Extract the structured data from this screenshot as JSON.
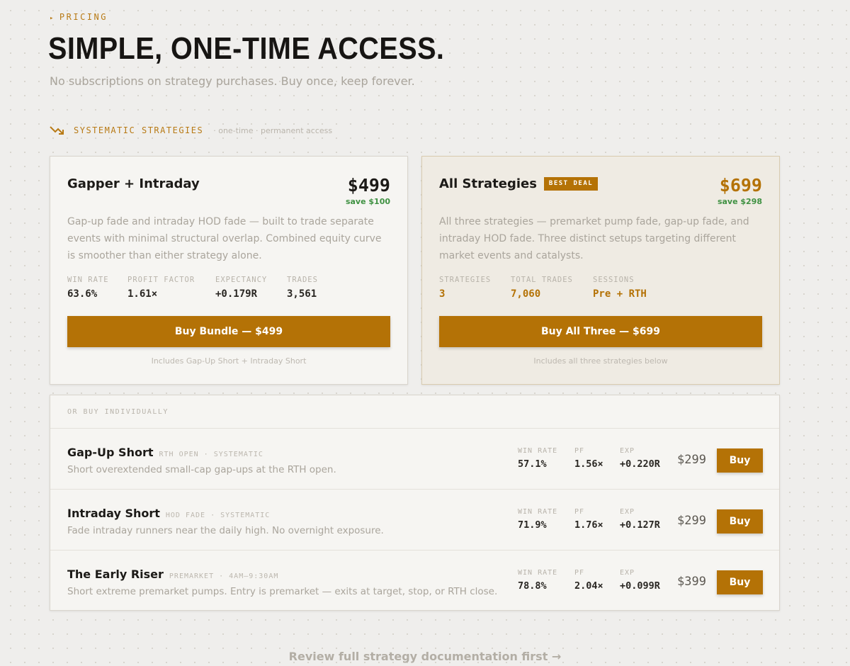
{
  "header": {
    "section_label": "PRICING",
    "title": "SIMPLE, ONE-TIME ACCESS.",
    "subtitle": "No subscriptions on strategy purchases. Buy once, keep forever."
  },
  "category": {
    "label": "SYSTEMATIC STRATEGIES",
    "note": "· one-time · permanent access",
    "icon": "trend-down-icon"
  },
  "colors": {
    "accent": "#b47206",
    "save_green": "#3f9142",
    "background": "#efeeec"
  },
  "bundle_card": {
    "title": "Gapper + Intraday",
    "price": "$499",
    "save": "save $100",
    "description": "Gap-up fade and intraday HOD fade — built to trade separate events with minimal structural overlap. Combined equity curve is smoother than either strategy alone.",
    "stats": [
      {
        "label": "WIN RATE",
        "value": "63.6%"
      },
      {
        "label": "PROFIT FACTOR",
        "value": "1.61×"
      },
      {
        "label": "EXPECTANCY",
        "value": "+0.179R"
      },
      {
        "label": "TRADES",
        "value": "3,561"
      }
    ],
    "cta": "Buy Bundle — $499",
    "footnote": "Includes Gap-Up Short + Intraday Short"
  },
  "all_card": {
    "title": "All Strategies",
    "badge": "BEST DEAL",
    "price": "$699",
    "save": "save $298",
    "description": "All three strategies — premarket pump fade, gap-up fade, and intraday HOD fade. Three distinct setups targeting different market events and catalysts.",
    "stats": [
      {
        "label": "STRATEGIES",
        "value": "3"
      },
      {
        "label": "TOTAL TRADES",
        "value": "7,060"
      },
      {
        "label": "SESSIONS",
        "value": "Pre + RTH"
      }
    ],
    "cta": "Buy All Three — $699",
    "footnote": "Includes all three strategies below"
  },
  "individual": {
    "heading": "OR BUY INDIVIDUALLY",
    "stat_labels": {
      "win_rate": "WIN RATE",
      "pf": "PF",
      "exp": "EXP"
    },
    "buy_label": "Buy",
    "items": [
      {
        "name": "Gap-Up Short",
        "tag": "RTH OPEN · SYSTEMATIC",
        "description": "Short overextended small-cap gap-ups at the RTH open.",
        "win_rate": "57.1%",
        "pf": "1.56×",
        "exp": "+0.220R",
        "price": "$299"
      },
      {
        "name": "Intraday Short",
        "tag": "HOD FADE · SYSTEMATIC",
        "description": "Fade intraday runners near the daily high. No overnight exposure.",
        "win_rate": "71.9%",
        "pf": "1.76×",
        "exp": "+0.127R",
        "price": "$299"
      },
      {
        "name": "The Early Riser",
        "tag": "PREMARKET · 4AM–9:30AM",
        "description": "Short extreme premarket pumps. Entry is premarket — exits at target, stop, or RTH close.",
        "win_rate": "78.8%",
        "pf": "2.04×",
        "exp": "+0.099R",
        "price": "$399"
      }
    ]
  },
  "footer_link": "Review full strategy documentation first →"
}
